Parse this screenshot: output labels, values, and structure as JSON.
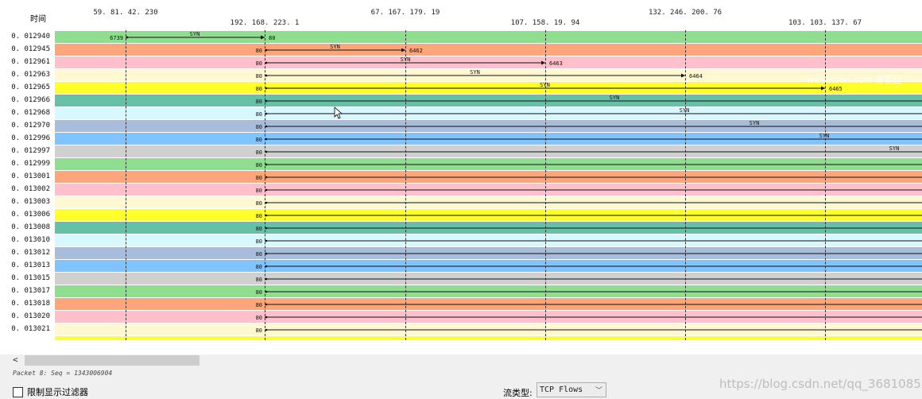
{
  "header": {
    "time_label": "时间"
  },
  "hosts": [
    {
      "addr": "59. 81. 42. 230",
      "row": 0
    },
    {
      "addr": "192. 168. 223. 1",
      "row": 1
    },
    {
      "addr": "67. 167. 179. 19",
      "row": 0
    },
    {
      "addr": "107. 158. 19. 94",
      "row": 1
    },
    {
      "addr": "132. 246. 200. 76",
      "row": 0
    },
    {
      "addr": "103. 103. 137. 67",
      "row": 1
    }
  ],
  "row_colors": [
    "#8fde8f",
    "#ffa57a",
    "#ffc0cb",
    "#fff8d0",
    "#ffff2a",
    "#66c0a8",
    "#d8f8ff",
    "#a8bcdc",
    "#80c4ff",
    "#d0d0d0"
  ],
  "rows": [
    {
      "time": "0. 012940",
      "from_host": 0,
      "to_host": 1,
      "src_port": "6739",
      "dst_port": "80",
      "label": "SYN"
    },
    {
      "time": "0. 012945",
      "from_host": 1,
      "to_host": 2,
      "src_port": "80",
      "dst_port": "6462",
      "label": "SYN"
    },
    {
      "time": "0. 012961",
      "from_host": 1,
      "to_host": 3,
      "src_port": "80",
      "dst_port": "6463",
      "label": "SYN"
    },
    {
      "time": "0. 012963",
      "from_host": 1,
      "to_host": 4,
      "src_port": "80",
      "dst_port": "6464",
      "label": "SYN"
    },
    {
      "time": "0. 012965",
      "from_host": 1,
      "to_host": 5,
      "src_port": "80",
      "dst_port": "6465",
      "label": "SYN"
    },
    {
      "time": "0. 012966",
      "from_host": 1,
      "to_host": 6,
      "src_port": "80",
      "dst_port": "",
      "label": "SYN"
    },
    {
      "time": "0. 012968",
      "from_host": 1,
      "to_host": 6,
      "src_port": "80",
      "dst_port": "",
      "label": "SYN"
    },
    {
      "time": "0. 012970",
      "from_host": 1,
      "to_host": 6,
      "src_port": "80",
      "dst_port": "",
      "label": "SYN"
    },
    {
      "time": "0. 012996",
      "from_host": 1,
      "to_host": 6,
      "src_port": "80",
      "dst_port": "",
      "label": "SYN"
    },
    {
      "time": "0. 012997",
      "from_host": 1,
      "to_host": 6,
      "src_port": "80",
      "dst_port": "",
      "label": "SYN"
    },
    {
      "time": "0. 012999",
      "from_host": 1,
      "to_host": 6,
      "src_port": "80",
      "dst_port": "",
      "label": ""
    },
    {
      "time": "0. 013001",
      "from_host": 1,
      "to_host": 6,
      "src_port": "80",
      "dst_port": "",
      "label": ""
    },
    {
      "time": "0. 013002",
      "from_host": 1,
      "to_host": 6,
      "src_port": "80",
      "dst_port": "",
      "label": ""
    },
    {
      "time": "0. 013003",
      "from_host": 1,
      "to_host": 6,
      "src_port": "80",
      "dst_port": "",
      "label": ""
    },
    {
      "time": "0. 013006",
      "from_host": 1,
      "to_host": 6,
      "src_port": "80",
      "dst_port": "",
      "label": ""
    },
    {
      "time": "0. 013008",
      "from_host": 1,
      "to_host": 6,
      "src_port": "80",
      "dst_port": "",
      "label": ""
    },
    {
      "time": "0. 013010",
      "from_host": 1,
      "to_host": 6,
      "src_port": "80",
      "dst_port": "",
      "label": ""
    },
    {
      "time": "0. 013012",
      "from_host": 1,
      "to_host": 6,
      "src_port": "80",
      "dst_port": "",
      "label": ""
    },
    {
      "time": "0. 013013",
      "from_host": 1,
      "to_host": 6,
      "src_port": "80",
      "dst_port": "",
      "label": ""
    },
    {
      "time": "0. 013015",
      "from_host": 1,
      "to_host": 6,
      "src_port": "80",
      "dst_port": "",
      "label": ""
    },
    {
      "time": "0. 013017",
      "from_host": 1,
      "to_host": 6,
      "src_port": "80",
      "dst_port": "",
      "label": ""
    },
    {
      "time": "0. 013018",
      "from_host": 1,
      "to_host": 6,
      "src_port": "80",
      "dst_port": "",
      "label": ""
    },
    {
      "time": "0. 013020",
      "from_host": 1,
      "to_host": 6,
      "src_port": "80",
      "dst_port": "",
      "label": ""
    },
    {
      "time": "0. 013021",
      "from_host": 1,
      "to_host": 6,
      "src_port": "80",
      "dst_port": "",
      "label": ""
    }
  ],
  "scroll": {
    "left_arrow": "<"
  },
  "status_text": "Packet 8: Seq = 1343006904",
  "footer": {
    "limit_filter_label": "限制显示过滤器",
    "limit_filter_checked": false,
    "flow_type_label": "流类型:",
    "flow_type_value": "TCP Flows"
  },
  "watermark": "https://blog.csdn.net/qq_36810852",
  "watermark_overlay": "www.csdn.com 博客园"
}
